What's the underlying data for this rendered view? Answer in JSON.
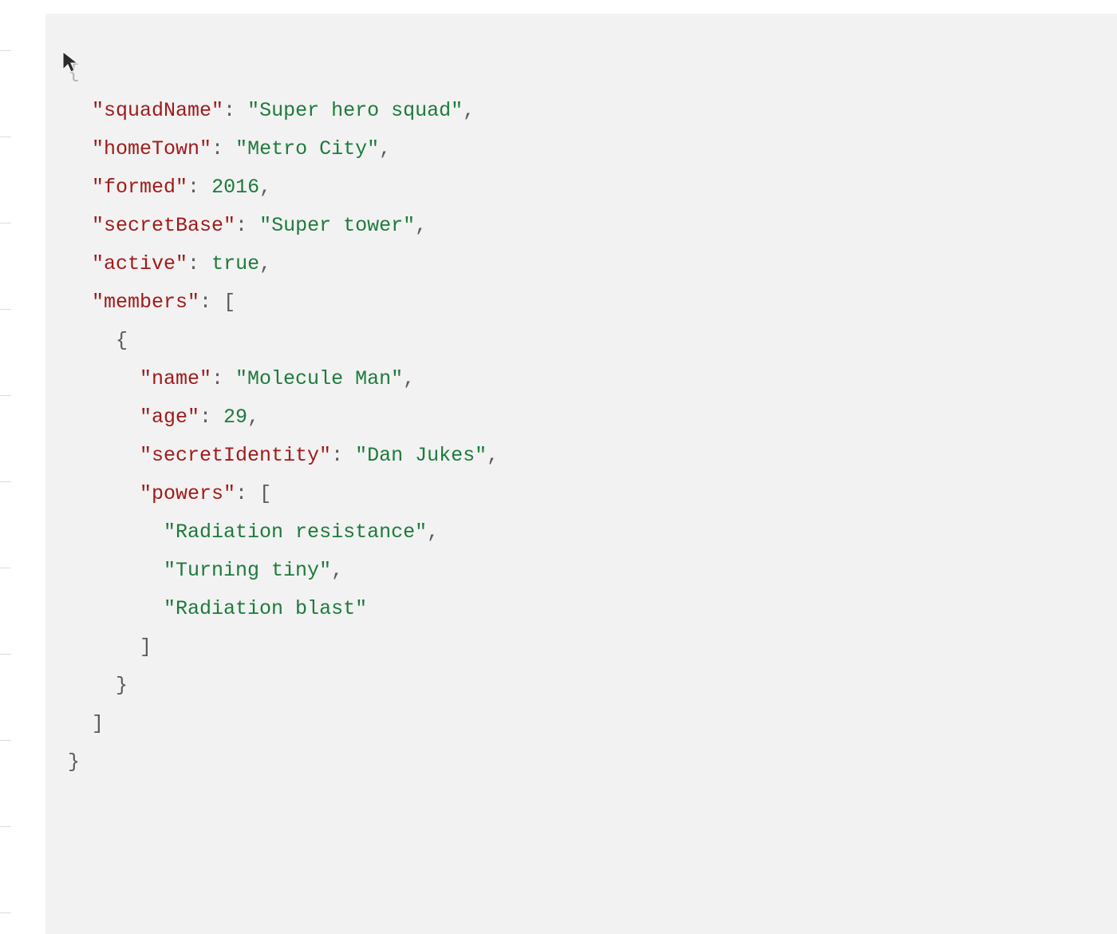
{
  "code": {
    "line1": "{",
    "squadName": {
      "key": "\"squadName\"",
      "value": "\"Super hero squad\""
    },
    "homeTown": {
      "key": "\"homeTown\"",
      "value": "\"Metro City\""
    },
    "formed": {
      "key": "\"formed\"",
      "value": "2016"
    },
    "secretBase": {
      "key": "\"secretBase\"",
      "value": "\"Super tower\""
    },
    "active": {
      "key": "\"active\"",
      "value": "true"
    },
    "members": {
      "key": "\"members\""
    },
    "memberName": {
      "key": "\"name\"",
      "value": "\"Molecule Man\""
    },
    "memberAge": {
      "key": "\"age\"",
      "value": "29"
    },
    "memberSecretIdentity": {
      "key": "\"secretIdentity\"",
      "value": "\"Dan Jukes\""
    },
    "memberPowers": {
      "key": "\"powers\""
    },
    "power0": "\"Radiation resistance\"",
    "power1": "\"Turning tiny\"",
    "power2": "\"Radiation blast\"",
    "punct": {
      "colon": ": ",
      "comma": ",",
      "openBracket": "[",
      "closeBracket": "]",
      "openBrace": "{",
      "closeBrace": "}",
      "sp2": "  ",
      "sp4": "    ",
      "sp6": "      ",
      "sp8": "        "
    }
  }
}
